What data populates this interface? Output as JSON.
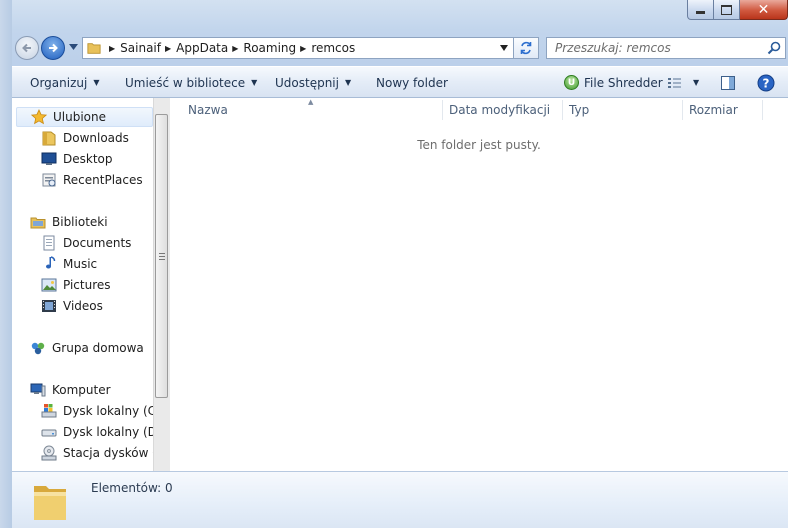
{
  "window": {
    "buttons": {
      "minimize": "minimize-icon",
      "maximize": "maximize-icon",
      "close": "close-icon"
    }
  },
  "address": {
    "crumbs": [
      "Sainaif",
      "AppData",
      "Roaming",
      "remcos"
    ]
  },
  "search": {
    "placeholder": "Przeszukaj: remcos"
  },
  "toolbar": {
    "organize": "Organizuj",
    "library": "Umieść w bibliotece",
    "share": "Udostępnij",
    "new_folder": "Nowy folder",
    "shredder": "File Shredder"
  },
  "sidebar": {
    "favorites": {
      "label": "Ulubione",
      "items": [
        "Downloads",
        "Desktop",
        "RecentPlaces"
      ]
    },
    "libraries": {
      "label": "Biblioteki",
      "items": [
        "Documents",
        "Music",
        "Pictures",
        "Videos"
      ]
    },
    "homegroup": {
      "label": "Grupa domowa"
    },
    "computer": {
      "label": "Komputer",
      "items": [
        "Dysk lokalny (C:)",
        "Dysk lokalny (D:)",
        "Stacja dysków CD"
      ]
    }
  },
  "columns": [
    "Nazwa",
    "Data modyfikacji",
    "Typ",
    "Rozmiar"
  ],
  "content": {
    "empty_message": "Ten folder jest pusty."
  },
  "details": {
    "count": "Elementów: 0"
  },
  "colors": {
    "accent": "#1f5fbf",
    "frame": "#c2d5ec",
    "close": "#d0583f"
  }
}
